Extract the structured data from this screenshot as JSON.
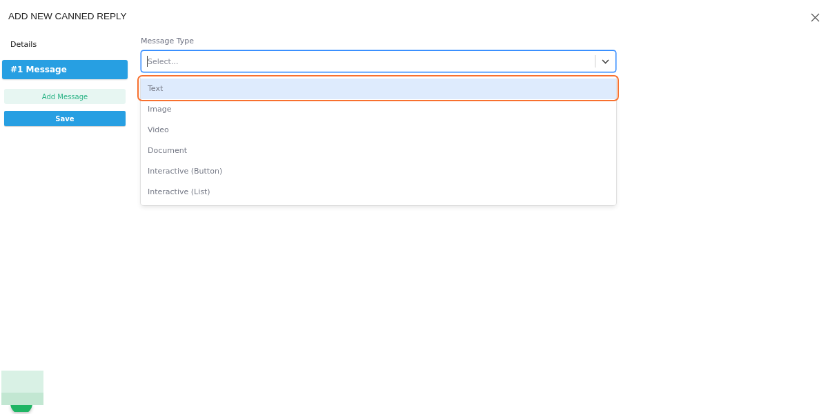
{
  "dialog": {
    "title": "ADD NEW CANNED REPLY"
  },
  "sidebar": {
    "heading": "Details",
    "items": [
      {
        "label": "#1 Message",
        "selected": true
      }
    ],
    "add_button": "Add Message",
    "save_button": "Save"
  },
  "form": {
    "label": "Message Type",
    "select": {
      "placeholder": "Select...",
      "expanded": true
    },
    "options": [
      {
        "label": "Text",
        "selected": true,
        "outlined": true
      },
      {
        "label": "Image",
        "selected": false,
        "outlined": false
      },
      {
        "label": "Video",
        "selected": false,
        "outlined": false
      },
      {
        "label": "Document",
        "selected": false,
        "outlined": false
      },
      {
        "label": "Interactive (Button)",
        "selected": false,
        "outlined": false
      },
      {
        "label": "Interactive (List)",
        "selected": false,
        "outlined": false
      }
    ]
  }
}
